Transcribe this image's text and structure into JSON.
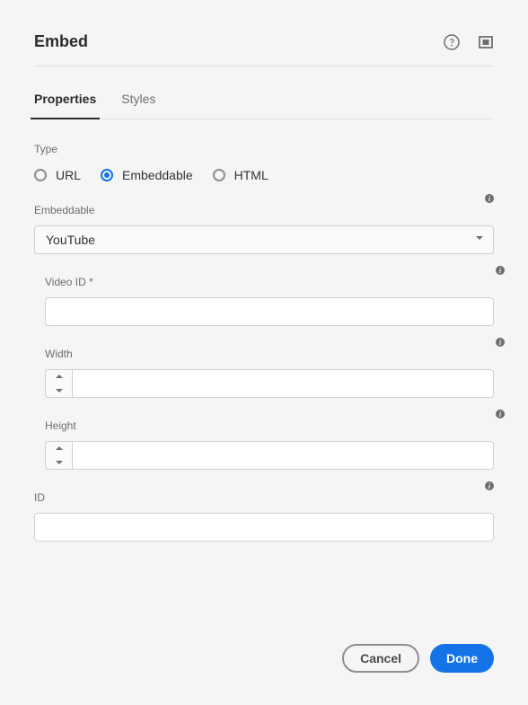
{
  "header": {
    "title": "Embed"
  },
  "tabs": {
    "properties": "Properties",
    "styles": "Styles"
  },
  "type": {
    "label": "Type",
    "options": {
      "url": "URL",
      "embeddable": "Embeddable",
      "html": "HTML"
    },
    "selected": "embeddable"
  },
  "embeddable": {
    "label": "Embeddable",
    "value": "YouTube"
  },
  "videoId": {
    "label": "Video ID *",
    "value": ""
  },
  "width": {
    "label": "Width",
    "value": ""
  },
  "height": {
    "label": "Height",
    "value": ""
  },
  "id": {
    "label": "ID",
    "value": ""
  },
  "footer": {
    "cancel": "Cancel",
    "done": "Done"
  }
}
